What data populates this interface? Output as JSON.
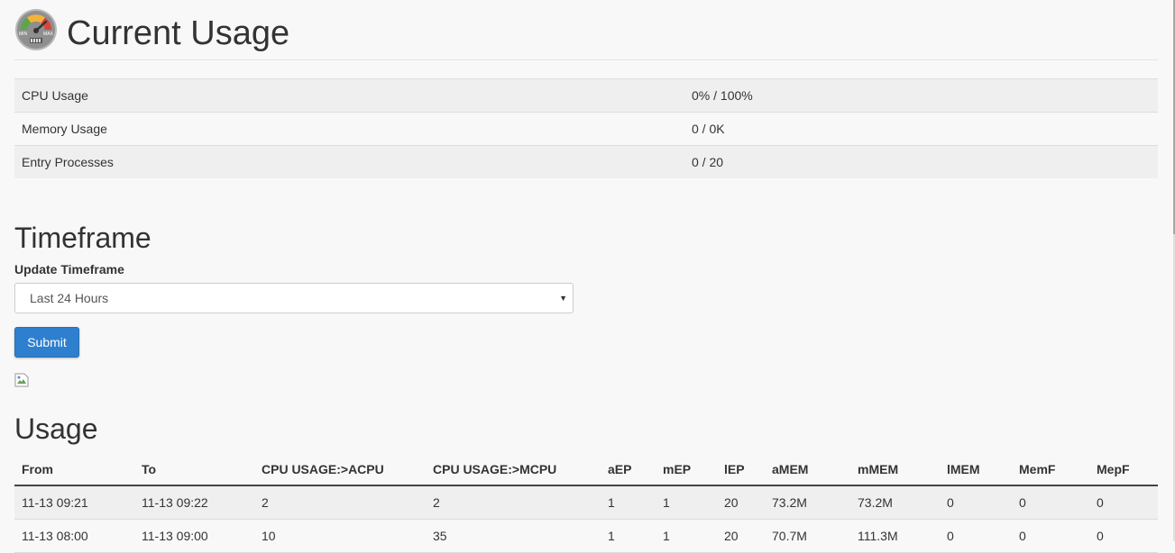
{
  "header": {
    "title": "Current Usage",
    "icon": "speedometer-icon",
    "gauge_min": "MIN",
    "gauge_max": "MAX"
  },
  "stats": [
    {
      "label": "CPU Usage",
      "value": "0% / 100%"
    },
    {
      "label": "Memory Usage",
      "value": "0 / 0K"
    },
    {
      "label": "Entry Processes",
      "value": "0 / 20"
    }
  ],
  "timeframe": {
    "title": "Timeframe",
    "field_label": "Update Timeframe",
    "selected": "Last 24 Hours",
    "submit_label": "Submit"
  },
  "usage": {
    "title": "Usage",
    "columns": [
      "From",
      "To",
      "CPU USAGE:>ACPU",
      "CPU USAGE:>MCPU",
      "aEP",
      "mEP",
      "lEP",
      "aMEM",
      "mMEM",
      "lMEM",
      "MemF",
      "MepF"
    ],
    "rows": [
      [
        "11-13 09:21",
        "11-13 09:22",
        "2",
        "2",
        "1",
        "1",
        "20",
        "73.2M",
        "73.2M",
        "0",
        "0",
        "0"
      ],
      [
        "11-13 08:00",
        "11-13 09:00",
        "10",
        "35",
        "1",
        "1",
        "20",
        "70.7M",
        "111.3M",
        "0",
        "0",
        "0"
      ]
    ]
  },
  "colors": {
    "accent": "#2f7fcf",
    "background": "#f8f8f8",
    "stripe": "#efefef"
  }
}
